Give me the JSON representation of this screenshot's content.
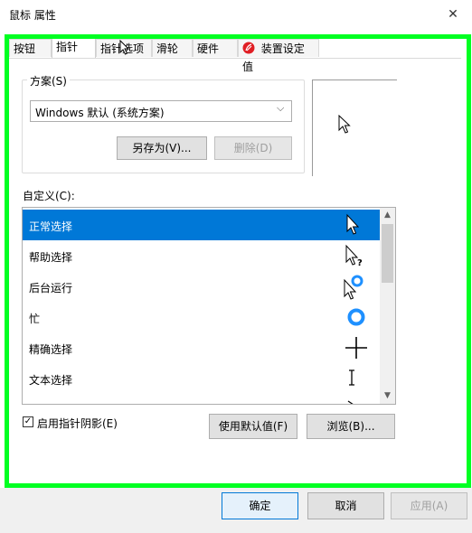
{
  "window": {
    "title": "鼠标 属性",
    "close_glyph": "✕"
  },
  "tabs": [
    {
      "label": "按钮"
    },
    {
      "label": "指针"
    },
    {
      "label": "指针选项"
    },
    {
      "label": "滑轮"
    },
    {
      "label": "硬件"
    },
    {
      "label": "装置设定值"
    }
  ],
  "active_tab": "指针",
  "scheme": {
    "label": "方案(S)",
    "selected": "Windows 默认 (系统方案)",
    "save_as_label": "另存为(V)...",
    "delete_label": "删除(D)"
  },
  "custom": {
    "label": "自定义(C):",
    "items": [
      {
        "label": "正常选择",
        "icon": "arrow-cursor-icon",
        "selected": true
      },
      {
        "label": "帮助选择",
        "icon": "help-cursor-icon",
        "selected": false
      },
      {
        "label": "后台运行",
        "icon": "working-in-background-cursor-icon",
        "selected": false
      },
      {
        "label": "忙",
        "icon": "busy-cursor-icon",
        "selected": false
      },
      {
        "label": "精确选择",
        "icon": "crosshair-cursor-icon",
        "selected": false
      },
      {
        "label": "文本选择",
        "icon": "text-beam-cursor-icon",
        "selected": false
      }
    ]
  },
  "shadow": {
    "label": "启用指针阴影(E)",
    "checked": true
  },
  "buttons": {
    "use_default": "使用默认值(F)",
    "browse": "浏览(B)...",
    "ok": "确定",
    "cancel": "取消",
    "apply": "应用(A)"
  },
  "colors": {
    "highlight_frame": "#00ff22",
    "selection": "#0078d7",
    "busy_ring": "#1e90ff",
    "device_settings_icon": "#e01e24"
  }
}
